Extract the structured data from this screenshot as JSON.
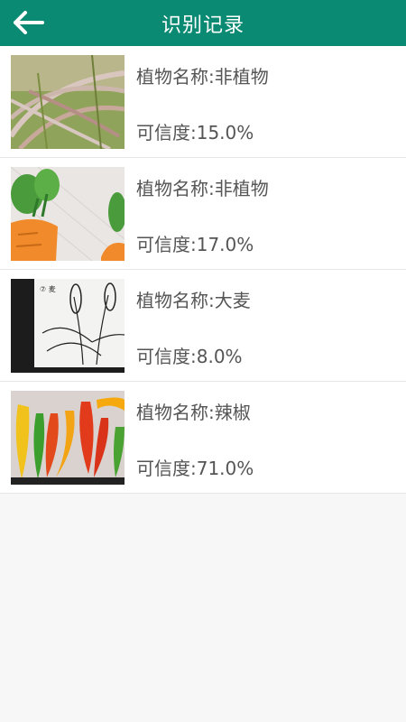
{
  "header": {
    "title": "识别记录",
    "back_icon": "arrow-left-icon",
    "color": "#0b8a73"
  },
  "records": [
    {
      "name": "植物名称:非植物",
      "confidence": "可信度:15.0%",
      "thumb": "rice-ears-photo"
    },
    {
      "name": "植物名称:非植物",
      "confidence": "可信度:17.0%",
      "thumb": "carrot-illustration"
    },
    {
      "name": "植物名称:大麦",
      "confidence": "可信度:8.0%",
      "thumb": "barley-drawing-photo"
    },
    {
      "name": "植物名称:辣椒",
      "confidence": "可信度:71.0%",
      "thumb": "peppers-photo"
    }
  ]
}
